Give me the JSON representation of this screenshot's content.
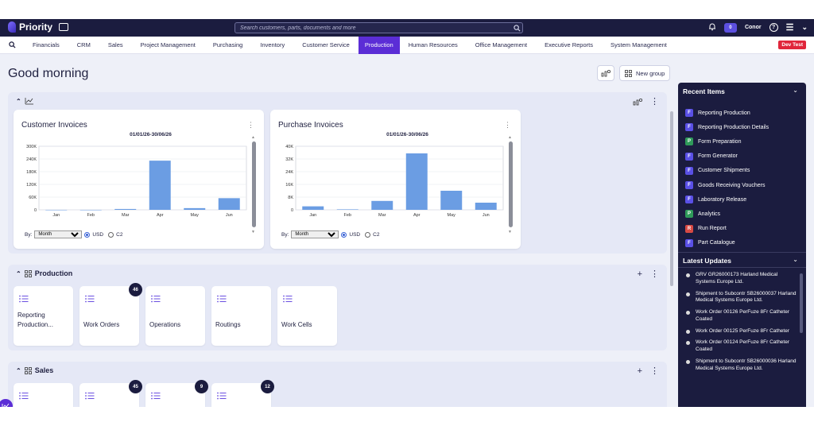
{
  "topbar": {
    "app_name": "Priority",
    "search_placeholder": "Search customers, parts, documents and more",
    "user_name": "Conor",
    "notif_count": "0"
  },
  "nav": {
    "items": [
      "Financials",
      "CRM",
      "Sales",
      "Project Management",
      "Purchasing",
      "Inventory",
      "Customer Service",
      "Production",
      "Human Resources",
      "Office Management",
      "Executive Reports",
      "System Management"
    ],
    "active": "Production",
    "env_badge": "Dev Test"
  },
  "main": {
    "greeting": "Good morning",
    "new_group_label": "New group"
  },
  "charts_section": {
    "cards": [
      {
        "title": "Customer Invoices",
        "date_range": "01/01/26-30/06/26",
        "by_label": "By:",
        "by_value": "Month",
        "currency_options": [
          "USD",
          "C2"
        ],
        "selected_currency": "USD"
      },
      {
        "title": "Purchase Invoices",
        "date_range": "01/01/26-30/06/26",
        "by_label": "By:",
        "by_value": "Month",
        "currency_options": [
          "USD",
          "C2"
        ],
        "selected_currency": "USD"
      }
    ]
  },
  "chart_data": [
    {
      "type": "bar",
      "title": "Customer Invoices",
      "categories": [
        "Jan",
        "Feb",
        "Mar",
        "Apr",
        "May",
        "Jun"
      ],
      "values": [
        0,
        0,
        4000,
        232000,
        8000,
        55000
      ],
      "yticks": [
        "0",
        "60K",
        "120K",
        "180K",
        "240K",
        "300K"
      ],
      "ylim": [
        0,
        300000
      ],
      "color": "#6b9de3"
    },
    {
      "type": "bar",
      "title": "Purchase Invoices",
      "categories": [
        "Jan",
        "Feb",
        "Mar",
        "Apr",
        "May",
        "Jun"
      ],
      "values": [
        2200,
        300,
        5600,
        35500,
        12000,
        4500
      ],
      "yticks": [
        "0",
        "8K",
        "16K",
        "24K",
        "32K",
        "40K"
      ],
      "ylim": [
        0,
        40000
      ],
      "color": "#6b9de3"
    }
  ],
  "production_section": {
    "title": "Production",
    "tiles": [
      {
        "label": "Reporting Production...",
        "badge": ""
      },
      {
        "label": "Work Orders",
        "badge": "46"
      },
      {
        "label": "Operations",
        "badge": ""
      },
      {
        "label": "Routings",
        "badge": ""
      },
      {
        "label": "Work Cells",
        "badge": ""
      }
    ]
  },
  "sales_section": {
    "title": "Sales",
    "badges": [
      "",
      "45",
      "9",
      "12"
    ]
  },
  "panel": {
    "recent_title": "Recent Items",
    "recent_items": [
      {
        "badge": "F",
        "kind": "f",
        "label": "Reporting Production"
      },
      {
        "badge": "F",
        "kind": "f",
        "label": "Reporting Production Details"
      },
      {
        "badge": "P",
        "kind": "p",
        "label": "Form Preparation"
      },
      {
        "badge": "F",
        "kind": "f",
        "label": "Form Generator"
      },
      {
        "badge": "F",
        "kind": "f",
        "label": "Customer Shipments"
      },
      {
        "badge": "F",
        "kind": "f",
        "label": "Goods Receiving Vouchers"
      },
      {
        "badge": "F",
        "kind": "f",
        "label": "Laboratory Release"
      },
      {
        "badge": "P",
        "kind": "p",
        "label": "Analytics"
      },
      {
        "badge": "R",
        "kind": "r",
        "label": "Run Report"
      },
      {
        "badge": "F",
        "kind": "f",
        "label": "Part Catalogue"
      }
    ],
    "updates_title": "Latest Updates",
    "updates": [
      "GRV GR26000173 Harland Medical Systems Europe Ltd.",
      "Shipment to Subcontr SB26000037 Harland Medical Systems Europe Ltd.",
      "Work Order 00126 PerFuze 8Fr Catheter Coated",
      "Work Order 00125 PerFuze 8Fr Catheter",
      "Work Order 00124 PerFuze 8Fr Catheter Coated",
      "Shipment to Subcontr SB26000036 Harland Medical Systems Europe Ltd."
    ]
  }
}
